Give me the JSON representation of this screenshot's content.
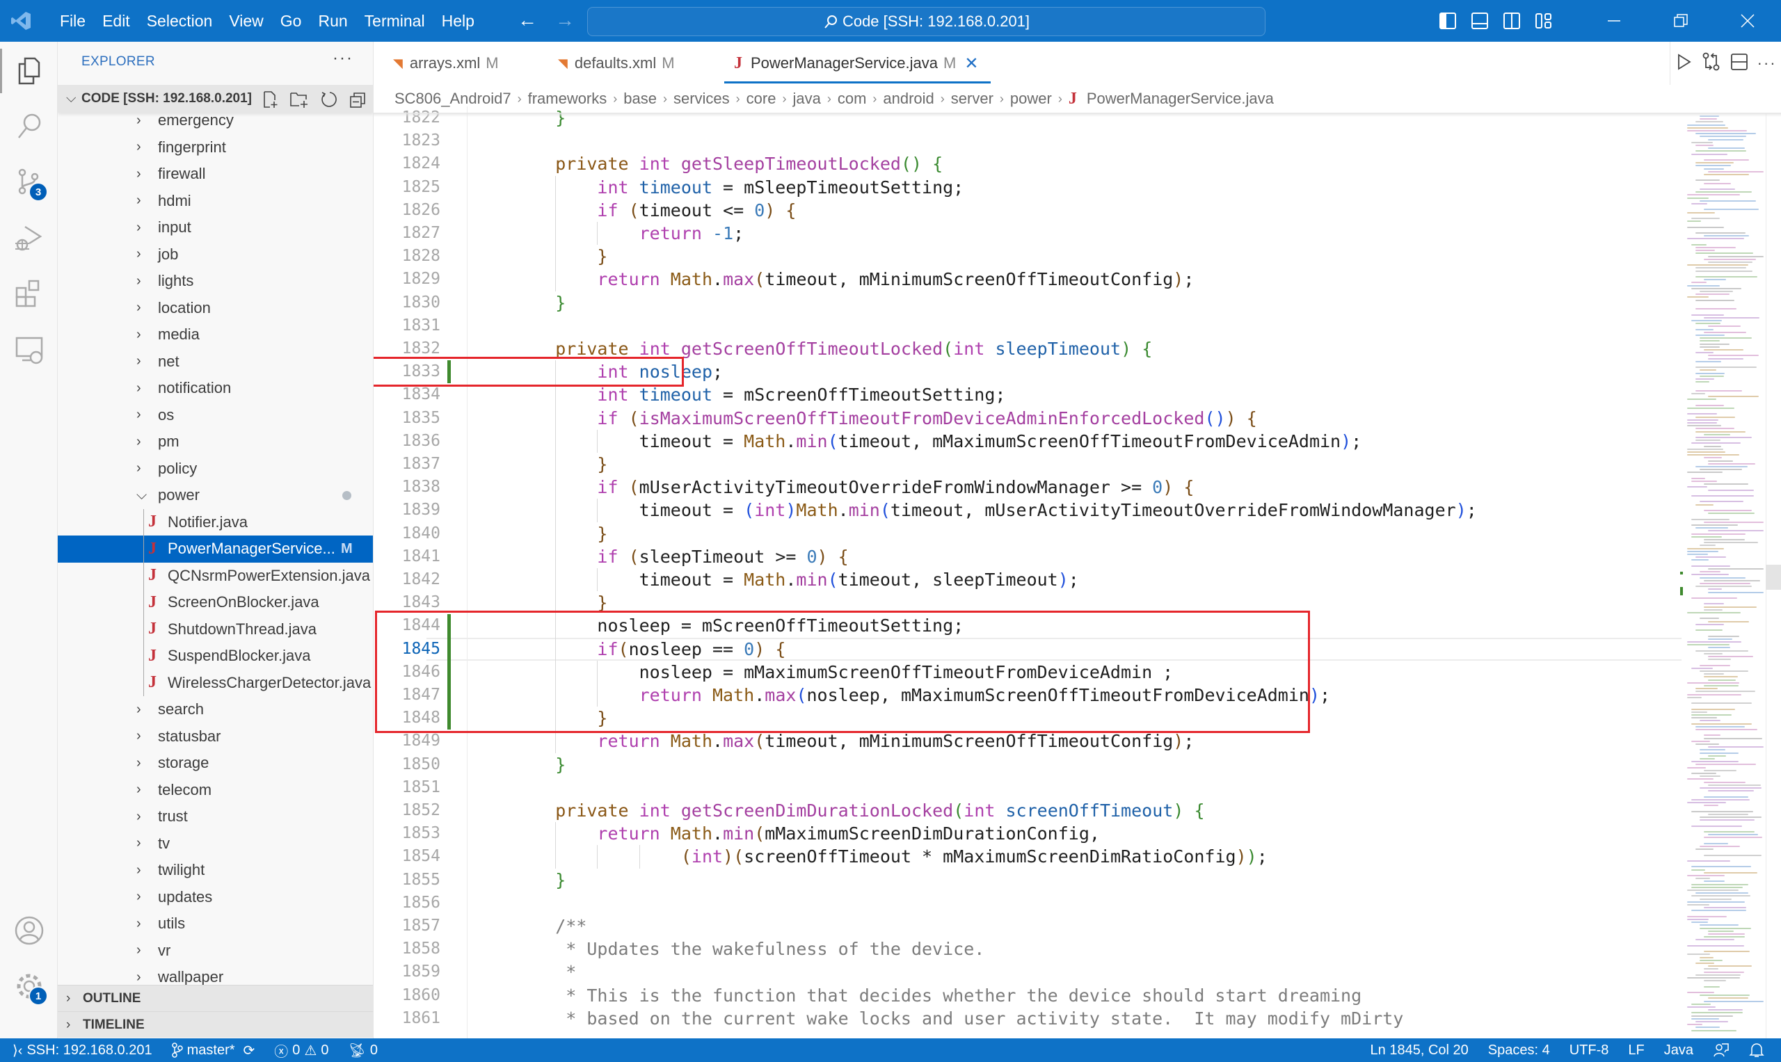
{
  "titlebar": {
    "menu": [
      "File",
      "Edit",
      "Selection",
      "View",
      "Go",
      "Run",
      "Terminal",
      "Help"
    ],
    "command_center": "Code [SSH: 192.168.0.201]",
    "back_icon": "arrow-left",
    "forward_icon": "arrow-right",
    "layout_icons": [
      "toggle-primary-sidebar",
      "toggle-panel",
      "toggle-secondary-sidebar",
      "customize-layout"
    ],
    "window_controls": [
      "minimize",
      "restore",
      "close"
    ]
  },
  "activitybar": {
    "items": [
      {
        "name": "explorer",
        "active": true
      },
      {
        "name": "search"
      },
      {
        "name": "source-control",
        "badge": "3"
      },
      {
        "name": "run-and-debug"
      },
      {
        "name": "extensions"
      },
      {
        "name": "remote-explorer"
      }
    ],
    "bottom": [
      {
        "name": "accounts"
      },
      {
        "name": "manage",
        "badge": "1"
      }
    ]
  },
  "sidebar": {
    "title": "EXPLORER",
    "more": "···",
    "section": "CODE [SSH: 192.168.0.201]",
    "tree": [
      {
        "label": "emergency",
        "type": "folder"
      },
      {
        "label": "fingerprint",
        "type": "folder"
      },
      {
        "label": "firewall",
        "type": "folder"
      },
      {
        "label": "hdmi",
        "type": "folder"
      },
      {
        "label": "input",
        "type": "folder"
      },
      {
        "label": "job",
        "type": "folder"
      },
      {
        "label": "lights",
        "type": "folder"
      },
      {
        "label": "location",
        "type": "folder"
      },
      {
        "label": "media",
        "type": "folder"
      },
      {
        "label": "net",
        "type": "folder"
      },
      {
        "label": "notification",
        "type": "folder"
      },
      {
        "label": "os",
        "type": "folder"
      },
      {
        "label": "pm",
        "type": "folder"
      },
      {
        "label": "policy",
        "type": "folder"
      },
      {
        "label": "power",
        "type": "folder-open",
        "modified_dot": true
      },
      {
        "label": "Notifier.java",
        "type": "file"
      },
      {
        "label": "PowerManagerService...",
        "type": "file",
        "selected": true,
        "flag": "M"
      },
      {
        "label": "QCNsrmPowerExtension.java",
        "type": "file"
      },
      {
        "label": "ScreenOnBlocker.java",
        "type": "file"
      },
      {
        "label": "ShutdownThread.java",
        "type": "file"
      },
      {
        "label": "SuspendBlocker.java",
        "type": "file"
      },
      {
        "label": "WirelessChargerDetector.java",
        "type": "file"
      },
      {
        "label": "search",
        "type": "folder"
      },
      {
        "label": "statusbar",
        "type": "folder"
      },
      {
        "label": "storage",
        "type": "folder"
      },
      {
        "label": "telecom",
        "type": "folder"
      },
      {
        "label": "trust",
        "type": "folder"
      },
      {
        "label": "tv",
        "type": "folder"
      },
      {
        "label": "twilight",
        "type": "folder"
      },
      {
        "label": "updates",
        "type": "folder"
      },
      {
        "label": "utils",
        "type": "folder"
      },
      {
        "label": "vr",
        "type": "folder"
      },
      {
        "label": "wallpaper",
        "type": "folder"
      }
    ],
    "outline": "OUTLINE",
    "timeline": "TIMELINE"
  },
  "tabs": [
    {
      "label": "arrays.xml",
      "flag": "M",
      "icon": "xml-icon"
    },
    {
      "label": "defaults.xml",
      "flag": "M",
      "icon": "xml-icon"
    },
    {
      "label": "PowerManagerService.java",
      "flag": "M",
      "icon": "java-icon",
      "active": true,
      "close": "✕"
    }
  ],
  "breadcrumb": [
    "SC806_Android7",
    "frameworks",
    "base",
    "services",
    "core",
    "java",
    "com",
    "android",
    "server",
    "power",
    "PowerManagerService.java"
  ],
  "editor": {
    "current_line": 1845,
    "lines": [
      {
        "n": "1822",
        "text": "    }"
      },
      {
        "n": "1823",
        "text": ""
      },
      {
        "n": "1824",
        "text": "    private int getSleepTimeoutLocked() {"
      },
      {
        "n": "1825",
        "text": "        int timeout = mSleepTimeoutSetting;"
      },
      {
        "n": "1826",
        "text": "        if (timeout <= 0) {"
      },
      {
        "n": "1827",
        "text": "            return -1;"
      },
      {
        "n": "1828",
        "text": "        }"
      },
      {
        "n": "1829",
        "text": "        return Math.max(timeout, mMinimumScreenOffTimeoutConfig);"
      },
      {
        "n": "1830",
        "text": "    }"
      },
      {
        "n": "1831",
        "text": ""
      },
      {
        "n": "1832",
        "text": "    private int getScreenOffTimeoutLocked(int sleepTimeout) {"
      },
      {
        "n": "1833",
        "text": "        int nosleep;",
        "changed": true
      },
      {
        "n": "1834",
        "text": "        int timeout = mScreenOffTimeoutSetting;"
      },
      {
        "n": "1835",
        "text": "        if (isMaximumScreenOffTimeoutFromDeviceAdminEnforcedLocked()) {"
      },
      {
        "n": "1836",
        "text": "            timeout = Math.min(timeout, mMaximumScreenOffTimeoutFromDeviceAdmin);"
      },
      {
        "n": "1837",
        "text": "        }"
      },
      {
        "n": "1838",
        "text": "        if (mUserActivityTimeoutOverrideFromWindowManager >= 0) {"
      },
      {
        "n": "1839",
        "text": "            timeout = (int)Math.min(timeout, mUserActivityTimeoutOverrideFromWindowManager);"
      },
      {
        "n": "1840",
        "text": "        }"
      },
      {
        "n": "1841",
        "text": "        if (sleepTimeout >= 0) {"
      },
      {
        "n": "1842",
        "text": "            timeout = Math.min(timeout, sleepTimeout);"
      },
      {
        "n": "1843",
        "text": "        }"
      },
      {
        "n": "1844",
        "text": "        nosleep = mScreenOffTimeoutSetting;",
        "changed": true
      },
      {
        "n": "1845",
        "text": "        if(nosleep == 0) {",
        "changed": true
      },
      {
        "n": "1846",
        "text": "            nosleep = mMaximumScreenOffTimeoutFromDeviceAdmin ;",
        "changed": true
      },
      {
        "n": "1847",
        "text": "            return Math.max(nosleep, mMaximumScreenOffTimeoutFromDeviceAdmin);",
        "changed": true
      },
      {
        "n": "1848",
        "text": "        }",
        "changed": true
      },
      {
        "n": "1849",
        "text": "        return Math.max(timeout, mMinimumScreenOffTimeoutConfig);"
      },
      {
        "n": "1850",
        "text": "    }"
      },
      {
        "n": "1851",
        "text": ""
      },
      {
        "n": "1852",
        "text": "    private int getScreenDimDurationLocked(int screenOffTimeout) {"
      },
      {
        "n": "1853",
        "text": "        return Math.min(mMaximumScreenDimDurationConfig,"
      },
      {
        "n": "1854",
        "text": "                (int)(screenOffTimeout * mMaximumScreenDimRatioConfig));"
      },
      {
        "n": "1855",
        "text": "    }"
      },
      {
        "n": "1856",
        "text": ""
      },
      {
        "n": "1857",
        "text": "    /**"
      },
      {
        "n": "1858",
        "text": "     * Updates the wakefulness of the device."
      },
      {
        "n": "1859",
        "text": "     *"
      },
      {
        "n": "1860",
        "text": "     * This is the function that decides whether the device should start dreaming"
      },
      {
        "n": "1861",
        "text": "     * based on the current wake locks and user activity state.  It may modify mDirty"
      }
    ],
    "highlight_boxes": [
      {
        "from_line": "1833",
        "to_line": "1833",
        "color": "#e5252b"
      },
      {
        "from_line": "1844",
        "to_line": "1848",
        "color": "#e5252b"
      }
    ]
  },
  "statusbar": {
    "remote": "SSH: 192.168.0.201",
    "branch": "master*",
    "errors": "0",
    "warnings": "0",
    "ports": "0",
    "position": "Ln 1845, Col 20",
    "indent": "Spaces: 4",
    "encoding": "UTF-8",
    "eol": "LF",
    "language": "Java"
  }
}
